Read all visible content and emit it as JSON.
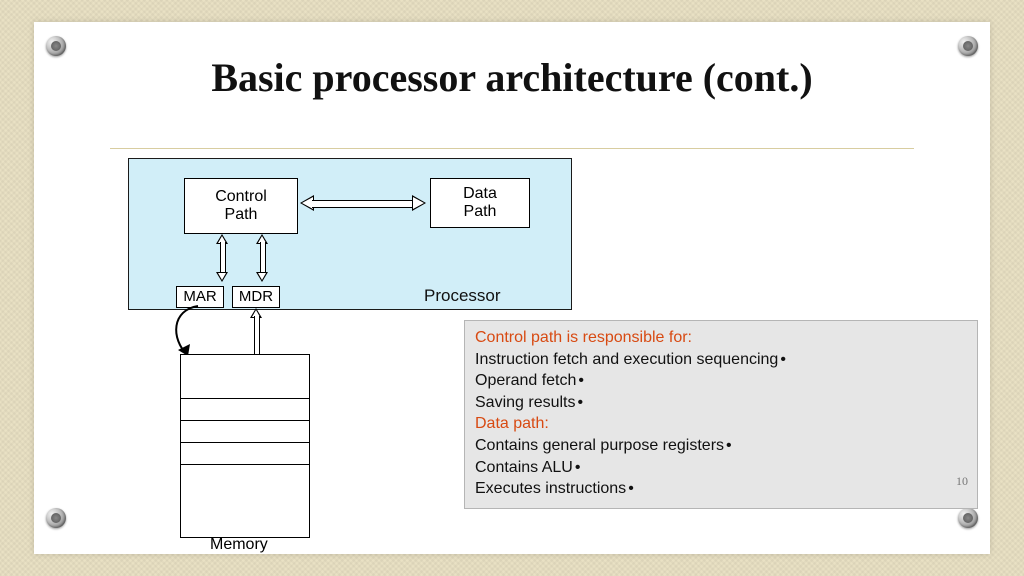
{
  "title": "Basic processor architecture (cont.)",
  "processor_label": "Processor",
  "boxes": {
    "control": "Control\nPath",
    "data": "Data\nPath",
    "mar": "MAR",
    "mdr": "MDR"
  },
  "memory_label": "Memory",
  "note": {
    "heading1": "Control path is responsible for:",
    "items1": [
      "Instruction fetch and execution sequencing",
      "Operand fetch",
      "Saving results"
    ],
    "heading2": "Data path:",
    "items2": [
      "Contains general purpose registers",
      "Contains ALU",
      "Executes instructions"
    ]
  },
  "page_number": "10"
}
